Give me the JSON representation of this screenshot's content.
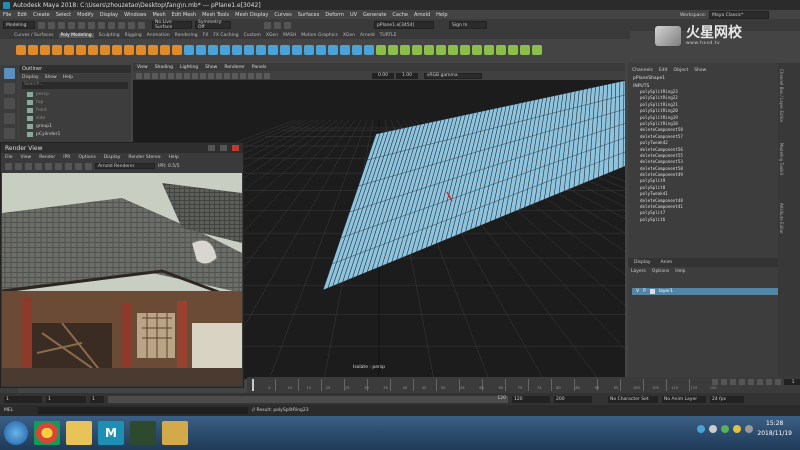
{
  "window": {
    "title": "Autodesk Maya 2018: C:\\Users\\zhouzetao\\Desktop\\fang\\n.mb*  ---  pPlane1.e[3042]"
  },
  "menu_bar": [
    "File",
    "Edit",
    "Create",
    "Select",
    "Modify",
    "Display",
    "Windows",
    "Mesh",
    "Edit Mesh",
    "Mesh Tools",
    "Mesh Display",
    "Curves",
    "Surfaces",
    "Deform",
    "UV",
    "Generate",
    "Cache",
    "Arnold",
    "Help"
  ],
  "workspace": {
    "label": "Workspace:",
    "value": "Maya Classic*"
  },
  "status_line": {
    "mode": "Modeling",
    "live_surface": "No Live Surface",
    "symmetry": "Symmetry: Off",
    "selection_field": "pPlane1.e[3454]",
    "sign_in": "Sign In"
  },
  "shelf_tabs": [
    {
      "label": "Curves / Surfaces",
      "active": false
    },
    {
      "label": "Poly Modeling",
      "active": true
    },
    {
      "label": "Sculpting",
      "active": false
    },
    {
      "label": "Rigging",
      "active": false
    },
    {
      "label": "Animation",
      "active": false
    },
    {
      "label": "Rendering",
      "active": false
    },
    {
      "label": "FX",
      "active": false
    },
    {
      "label": "FX Caching",
      "active": false
    },
    {
      "label": "Custom",
      "active": false
    },
    {
      "label": "XGen",
      "active": false
    },
    {
      "label": "MASH",
      "active": false
    },
    {
      "label": "Motion Graphics",
      "active": false
    },
    {
      "label": "XGen",
      "active": false
    },
    {
      "label": "Arnold",
      "active": false
    },
    {
      "label": "TURTLE",
      "active": false
    }
  ],
  "outliner": {
    "title": "Outliner",
    "menu": [
      "Display",
      "Show",
      "Help"
    ],
    "search_placeholder": "Search...",
    "items": [
      {
        "label": "persp",
        "visible": false
      },
      {
        "label": "top",
        "visible": false
      },
      {
        "label": "front",
        "visible": false
      },
      {
        "label": "side",
        "visible": false
      },
      {
        "label": "group1",
        "visible": true
      },
      {
        "label": "pCylinder1",
        "visible": true
      }
    ]
  },
  "viewport": {
    "menu": [
      "View",
      "Shading",
      "Lighting",
      "Show",
      "Renderer",
      "Panels"
    ],
    "field_a": "0.00",
    "field_b": "1.00",
    "color_space": "sRGB gamma",
    "camera_label": "persp",
    "isolate_label": "Isolate : persp"
  },
  "channel_box": {
    "tabs": [
      "Channels",
      "Edit",
      "Object",
      "Show"
    ],
    "shape_name": "pPlaneShape1",
    "inputs_label": "INPUTS",
    "history": [
      "polySplitRing23",
      "polySplitRing22",
      "polySplitRing21",
      "polySplitRing20",
      "polySplitRing19",
      "polySplitRing18",
      "deleteComponent58",
      "deleteComponent57",
      "polyTweak42",
      "deleteComponent56",
      "deleteComponent55",
      "deleteComponent53",
      "deleteComponent50",
      "deleteComponent49",
      "polySplit9",
      "polySplit8",
      "polyTweak41",
      "deleteComponent48",
      "deleteComponent41",
      "polySplit7",
      "polySplit6"
    ]
  },
  "layer_editor": {
    "tabs": [
      "Display",
      "Anim"
    ],
    "menu": [
      "Layers",
      "Options",
      "Help"
    ],
    "layer": {
      "v": "V",
      "p": "P",
      "name": "layer1"
    }
  },
  "side_tabs": [
    "Channel Box / Layer Editor",
    "Modeling Toolkit",
    "Attribute Editor"
  ],
  "render_view": {
    "title": "Render View",
    "menu": [
      "File",
      "View",
      "Render",
      "IPR",
      "Options",
      "Display",
      "Render Stereo",
      "Help"
    ],
    "renderer": "Arnold Renderer",
    "frame_label": "IPR: 0.5/5"
  },
  "timeline": {
    "ticks": [
      "5",
      "10",
      "15",
      "20",
      "25",
      "30",
      "35",
      "40",
      "45",
      "50",
      "55",
      "60",
      "65",
      "70",
      "75",
      "80",
      "85",
      "90",
      "95",
      "100",
      "105",
      "110",
      "115",
      "120"
    ],
    "current_frame": "1"
  },
  "range_bar": {
    "start": "1",
    "start2": "1",
    "current": "1",
    "end_inner": "120",
    "end_outer": "120",
    "max": "200",
    "character_set": "No Character Set",
    "anim_layer": "No Anim Layer",
    "fps": "24 fps"
  },
  "command_line": {
    "lang": "MEL",
    "result": "// Result: polySplitRing23"
  },
  "taskbar": {
    "time": "15:28",
    "date": "2018/11/19",
    "apps": [
      "Chrome",
      "Explorer",
      "Maya",
      "Screen",
      "Folder"
    ]
  },
  "watermark": {
    "text": "火星网校",
    "url": "www.hxsd.tv"
  },
  "colors": {
    "accent": "#5285a6",
    "mesh_face": "#8fc4de",
    "mesh_wire": "#1d2a33",
    "grid": "#3b3b3b",
    "grid_axis": "#111111",
    "selection_edge": "#e02020"
  }
}
